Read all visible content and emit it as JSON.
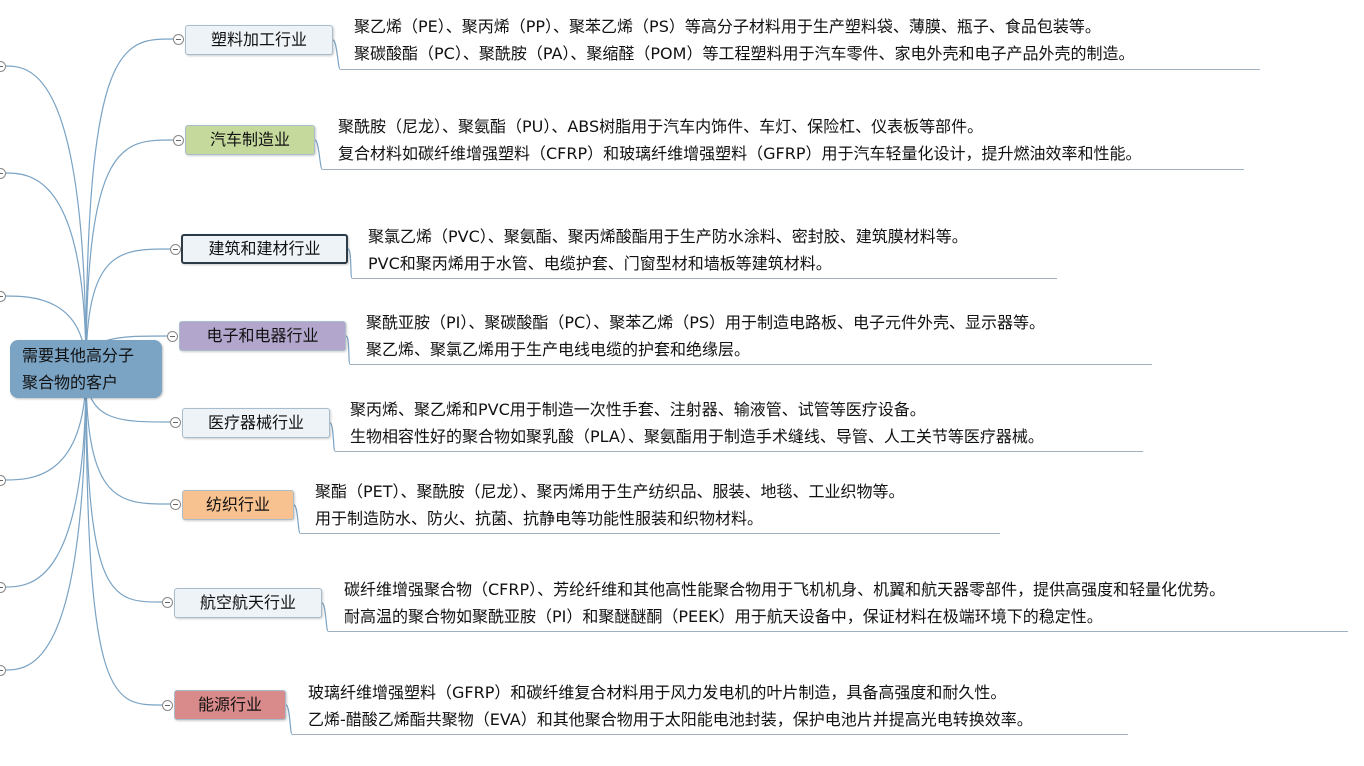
{
  "root": {
    "line1": "需要其他高分子",
    "line2": "聚合物的客户"
  },
  "branches": [
    {
      "label": "塑料加工行业",
      "color": "#eef3f7",
      "details": [
        "聚乙烯（PE）、聚丙烯（PP）、聚苯乙烯（PS）等高分子材料用于生产塑料袋、薄膜、瓶子、食品包装等。",
        "聚碳酸酯（PC）、聚酰胺（PA）、聚缩醛（POM）等工程塑料用于汽车零件、家电外壳和电子产品外壳的制造。"
      ]
    },
    {
      "label": "汽车制造业",
      "color": "#c5d99c",
      "details": [
        "聚酰胺（尼龙）、聚氨酯（PU）、ABS树脂用于汽车内饰件、车灯、保险杠、仪表板等部件。",
        "复合材料如碳纤维增强塑料（CFRP）和玻璃纤维增强塑料（GFRP）用于汽车轻量化设计，提升燃油效率和性能。"
      ]
    },
    {
      "label": "建筑和建材行业",
      "color": "#eef3f7",
      "details": [
        "聚氯乙烯（PVC）、聚氨酯、聚丙烯酸酯用于生产防水涂料、密封胶、建筑膜材料等。",
        "PVC和聚丙烯用于水管、电缆护套、门窗型材和墙板等建筑材料。"
      ]
    },
    {
      "label": "电子和电器行业",
      "color": "#b3a6cc",
      "details": [
        "聚酰亚胺（PI）、聚碳酸酯（PC）、聚苯乙烯（PS）用于制造电路板、电子元件外壳、显示器等。",
        "聚乙烯、聚氯乙烯用于生产电线电缆的护套和绝缘层。"
      ]
    },
    {
      "label": "医疗器械行业",
      "color": "#eef3f7",
      "details": [
        "聚丙烯、聚乙烯和PVC用于制造一次性手套、注射器、输液管、试管等医疗设备。",
        "生物相容性好的聚合物如聚乳酸（PLA）、聚氨酯用于制造手术缝线、导管、人工关节等医疗器械。"
      ]
    },
    {
      "label": "纺织行业",
      "color": "#f8c190",
      "details": [
        "聚酯（PET）、聚酰胺（尼龙）、聚丙烯用于生产纺织品、服装、地毯、工业织物等。",
        "用于制造防水、防火、抗菌、抗静电等功能性服装和织物材料。"
      ]
    },
    {
      "label": "航空航天行业",
      "color": "#eef3f7",
      "details": [
        "碳纤维增强聚合物（CFRP）、芳纶纤维和其他高性能聚合物用于飞机机身、机翼和航天器零部件，提供高强度和轻量化优势。",
        "耐高温的聚合物如聚酰亚胺（PI）和聚醚醚酮（PEEK）用于航天设备中，保证材料在极端环境下的稳定性。"
      ]
    },
    {
      "label": "能源行业",
      "color": "#d98a8a",
      "details": [
        "玻璃纤维增强塑料（GFRP）和碳纤维复合材料用于风力发电机的叶片制造，具备高强度和耐久性。",
        "乙烯-醋酸乙烯酯共聚物（EVA）和其他聚合物用于太阳能电池封装，保护电池片并提高光电转换效率。"
      ]
    }
  ]
}
